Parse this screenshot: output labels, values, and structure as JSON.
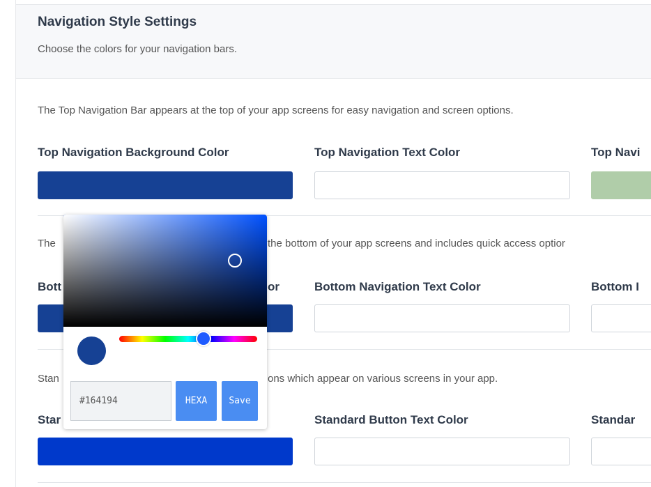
{
  "page": {
    "title": "Navigation Style Settings",
    "subtitle": "Choose the colors for your navigation bars."
  },
  "sections": {
    "top": {
      "description": "The Top Navigation Bar appears at the top of your app screens for easy navigation and screen options.",
      "fields": [
        {
          "label": "Top Navigation Background Color",
          "color": "#164194"
        },
        {
          "label": "Top Navigation Text Color",
          "color": "#ffffff"
        },
        {
          "label": "Top Navi",
          "color": "#b0cda9"
        }
      ]
    },
    "bottom": {
      "description_visible": "The",
      "description_tail": "the bottom of your app screens and includes quick access optior",
      "fields": [
        {
          "label": "Bott",
          "label_tail": "or",
          "color": "#164194"
        },
        {
          "label": "Bottom Navigation Text Color",
          "color": "#ffffff"
        },
        {
          "label": "Bottom I",
          "color": "#ffffff"
        }
      ]
    },
    "standard": {
      "description_visible": "Stan",
      "description_tail": "ons which appear on various screens in your app.",
      "fields": [
        {
          "label": "Star",
          "color": "#0039cb"
        },
        {
          "label": "Standard Button Text Color",
          "color": "#ffffff"
        },
        {
          "label": "Standar",
          "color": "#ffffff"
        }
      ]
    }
  },
  "picker": {
    "hue_color": "#0051ff",
    "current_color": "#164194",
    "hex_value": "#164194",
    "mode_label": "HEXA",
    "save_label": "Save"
  }
}
